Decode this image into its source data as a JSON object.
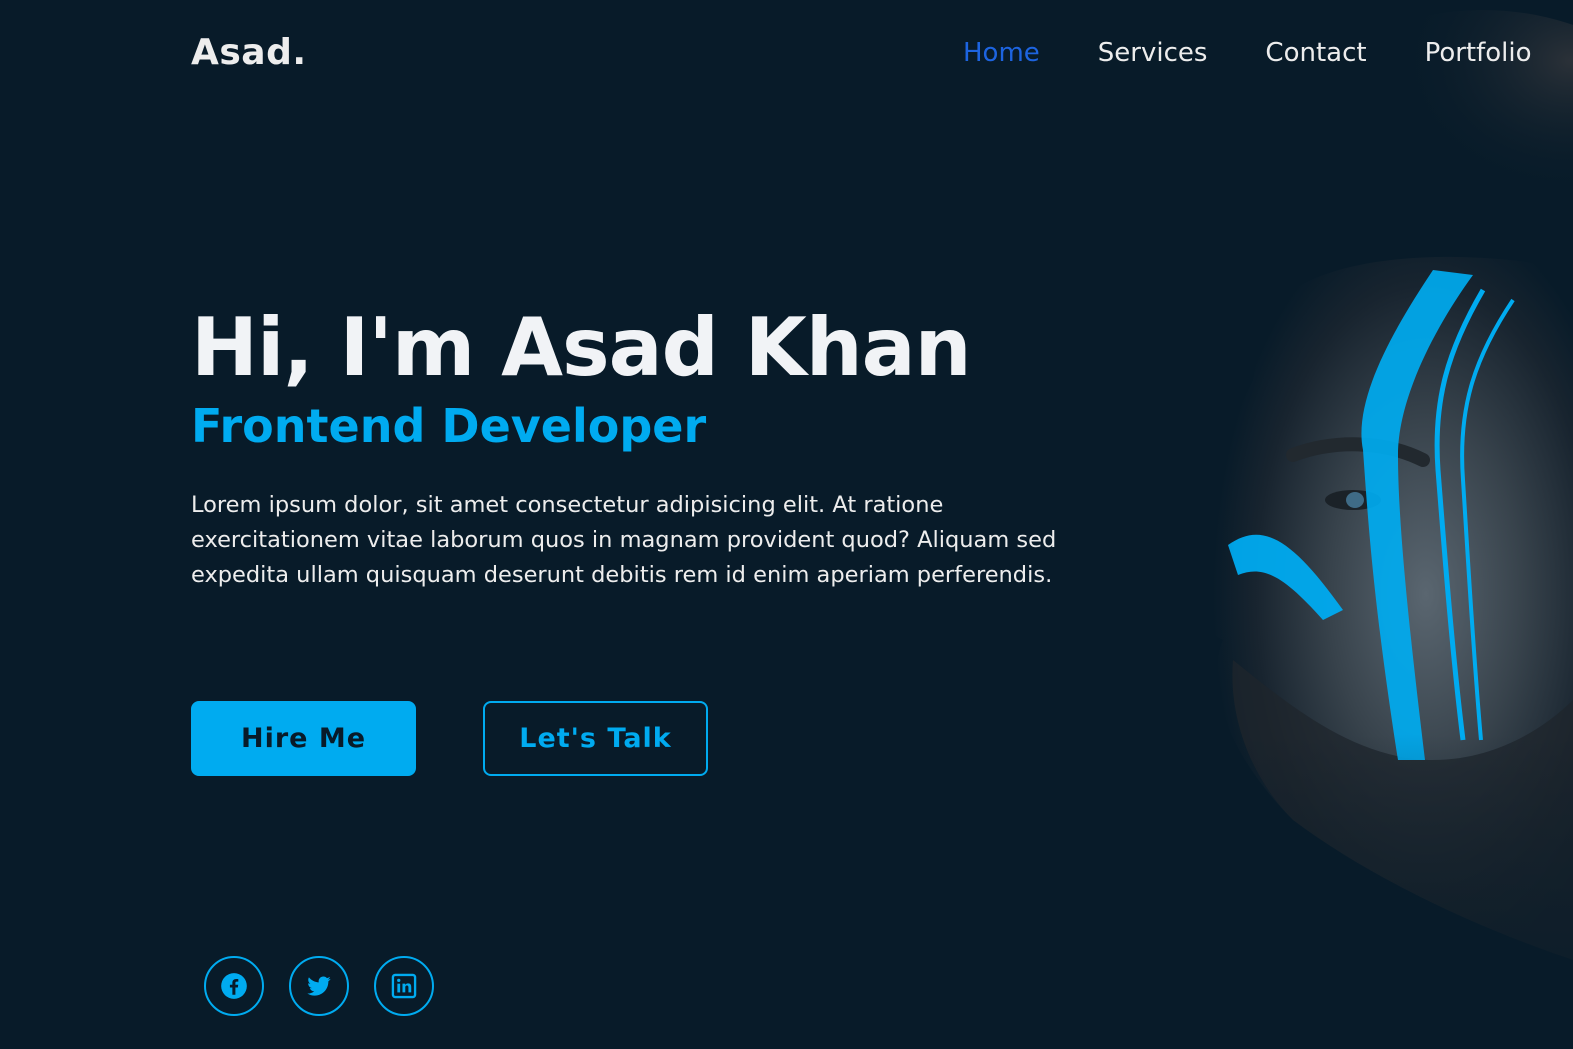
{
  "header": {
    "logo": "Asad.",
    "nav": [
      {
        "label": "Home",
        "active": true
      },
      {
        "label": "Services",
        "active": false
      },
      {
        "label": "Contact",
        "active": false
      },
      {
        "label": "Portfolio",
        "active": false
      }
    ]
  },
  "hero": {
    "title": "Hi, I'm Asad Khan",
    "subtitle": "Frontend Developer",
    "description": "Lorem ipsum dolor, sit amet consectetur adipisicing elit. At ratione exercitationem vitae laborum quos in magnam provident quod? Aliquam sed expedita ullam quisquam deserunt debitis rem id enim aperiam perferendis.",
    "buttons": {
      "primary": "Hire Me",
      "secondary": "Let's Talk"
    },
    "image": "portrait-photo"
  },
  "social": [
    {
      "icon": "facebook-icon"
    },
    {
      "icon": "twitter-icon"
    },
    {
      "icon": "linkedin-icon"
    }
  ],
  "colors": {
    "background": "#081b29",
    "accent": "#00abf0",
    "nav_active": "#1d64e0",
    "text": "#ededed"
  }
}
